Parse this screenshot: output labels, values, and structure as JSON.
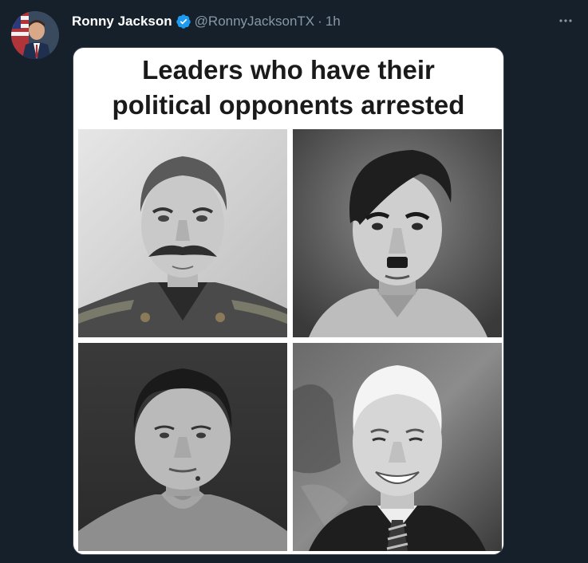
{
  "tweet": {
    "author_name": "Ronny Jackson",
    "handle": "@RonnyJacksonTX",
    "separator": "·",
    "time": "1h",
    "verified": true
  },
  "media": {
    "title_line1": "Leaders who have their",
    "title_line2": "political opponents arrested",
    "portraits": [
      "portrait-top-left",
      "portrait-top-right",
      "portrait-bottom-left",
      "portrait-bottom-right"
    ]
  },
  "icons": {
    "verified": "verified-badge-icon",
    "more": "more-options-icon"
  },
  "colors": {
    "background": "#15202b",
    "secondary_text": "#8899a6",
    "verified_blue": "#1d9bf0"
  }
}
